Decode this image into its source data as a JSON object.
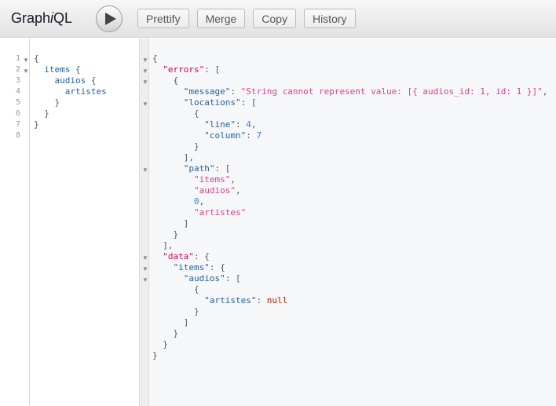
{
  "header": {
    "title_prefix": "Graph",
    "title_italic": "i",
    "title_suffix": "QL",
    "buttons": [
      "Prettify",
      "Merge",
      "Copy",
      "History"
    ]
  },
  "colors": {
    "key": "#1f61a0",
    "string": "#d64292",
    "number": "#2882f9",
    "null": "#b11a04",
    "top_key": "#d2054e"
  },
  "query": {
    "lines": [
      [
        [
          "p",
          "{"
        ]
      ],
      [
        [
          "p",
          "  "
        ],
        [
          "k",
          "items"
        ],
        [
          "p",
          " {"
        ]
      ],
      [
        [
          "p",
          "    "
        ],
        [
          "k",
          "audios"
        ],
        [
          "p",
          " {"
        ]
      ],
      [
        [
          "p",
          "      "
        ],
        [
          "k",
          "artistes"
        ]
      ],
      [
        [
          "p",
          "    }"
        ]
      ],
      [
        [
          "p",
          "  }"
        ]
      ],
      [
        [
          "p",
          "}"
        ]
      ],
      []
    ],
    "folds": [
      0,
      1
    ]
  },
  "result": {
    "lines": [
      [
        [
          "p",
          "{"
        ]
      ],
      [
        [
          "p",
          "  "
        ],
        [
          "tk",
          "\"errors\""
        ],
        [
          "p",
          ": ["
        ]
      ],
      [
        [
          "p",
          "    {"
        ]
      ],
      [
        [
          "p",
          "      "
        ],
        [
          "k",
          "\"message\""
        ],
        [
          "p",
          ": "
        ],
        [
          "s",
          "\"String cannot represent value: [{ audios_id: 1, id: 1 }]\""
        ],
        [
          "p",
          ","
        ]
      ],
      [
        [
          "p",
          "      "
        ],
        [
          "k",
          "\"locations\""
        ],
        [
          "p",
          ": ["
        ]
      ],
      [
        [
          "p",
          "        {"
        ]
      ],
      [
        [
          "p",
          "          "
        ],
        [
          "k",
          "\"line\""
        ],
        [
          "p",
          ": "
        ],
        [
          "n",
          "4"
        ],
        [
          "p",
          ","
        ]
      ],
      [
        [
          "p",
          "          "
        ],
        [
          "k",
          "\"column\""
        ],
        [
          "p",
          ": "
        ],
        [
          "n",
          "7"
        ]
      ],
      [
        [
          "p",
          "        }"
        ]
      ],
      [
        [
          "p",
          "      ],"
        ]
      ],
      [
        [
          "p",
          "      "
        ],
        [
          "k",
          "\"path\""
        ],
        [
          "p",
          ": ["
        ]
      ],
      [
        [
          "p",
          "        "
        ],
        [
          "s",
          "\"items\""
        ],
        [
          "p",
          ","
        ]
      ],
      [
        [
          "p",
          "        "
        ],
        [
          "s",
          "\"audios\""
        ],
        [
          "p",
          ","
        ]
      ],
      [
        [
          "p",
          "        "
        ],
        [
          "n",
          "0"
        ],
        [
          "p",
          ","
        ]
      ],
      [
        [
          "p",
          "        "
        ],
        [
          "s",
          "\"artistes\""
        ]
      ],
      [
        [
          "p",
          "      ]"
        ]
      ],
      [
        [
          "p",
          "    }"
        ]
      ],
      [
        [
          "p",
          "  ],"
        ]
      ],
      [
        [
          "p",
          "  "
        ],
        [
          "tk",
          "\"data\""
        ],
        [
          "p",
          ": {"
        ]
      ],
      [
        [
          "p",
          "    "
        ],
        [
          "k",
          "\"items\""
        ],
        [
          "p",
          ": {"
        ]
      ],
      [
        [
          "p",
          "      "
        ],
        [
          "k",
          "\"audios\""
        ],
        [
          "p",
          ": ["
        ]
      ],
      [
        [
          "p",
          "        {"
        ]
      ],
      [
        [
          "p",
          "          "
        ],
        [
          "k",
          "\"artistes\""
        ],
        [
          "p",
          ": "
        ],
        [
          "nl",
          "null"
        ]
      ],
      [
        [
          "p",
          "        }"
        ]
      ],
      [
        [
          "p",
          "      ]"
        ]
      ],
      [
        [
          "p",
          "    }"
        ]
      ],
      [
        [
          "p",
          "  }"
        ]
      ],
      [
        [
          "p",
          "}"
        ]
      ]
    ],
    "folds": [
      0,
      1,
      2,
      4,
      10,
      18,
      19,
      20
    ]
  }
}
